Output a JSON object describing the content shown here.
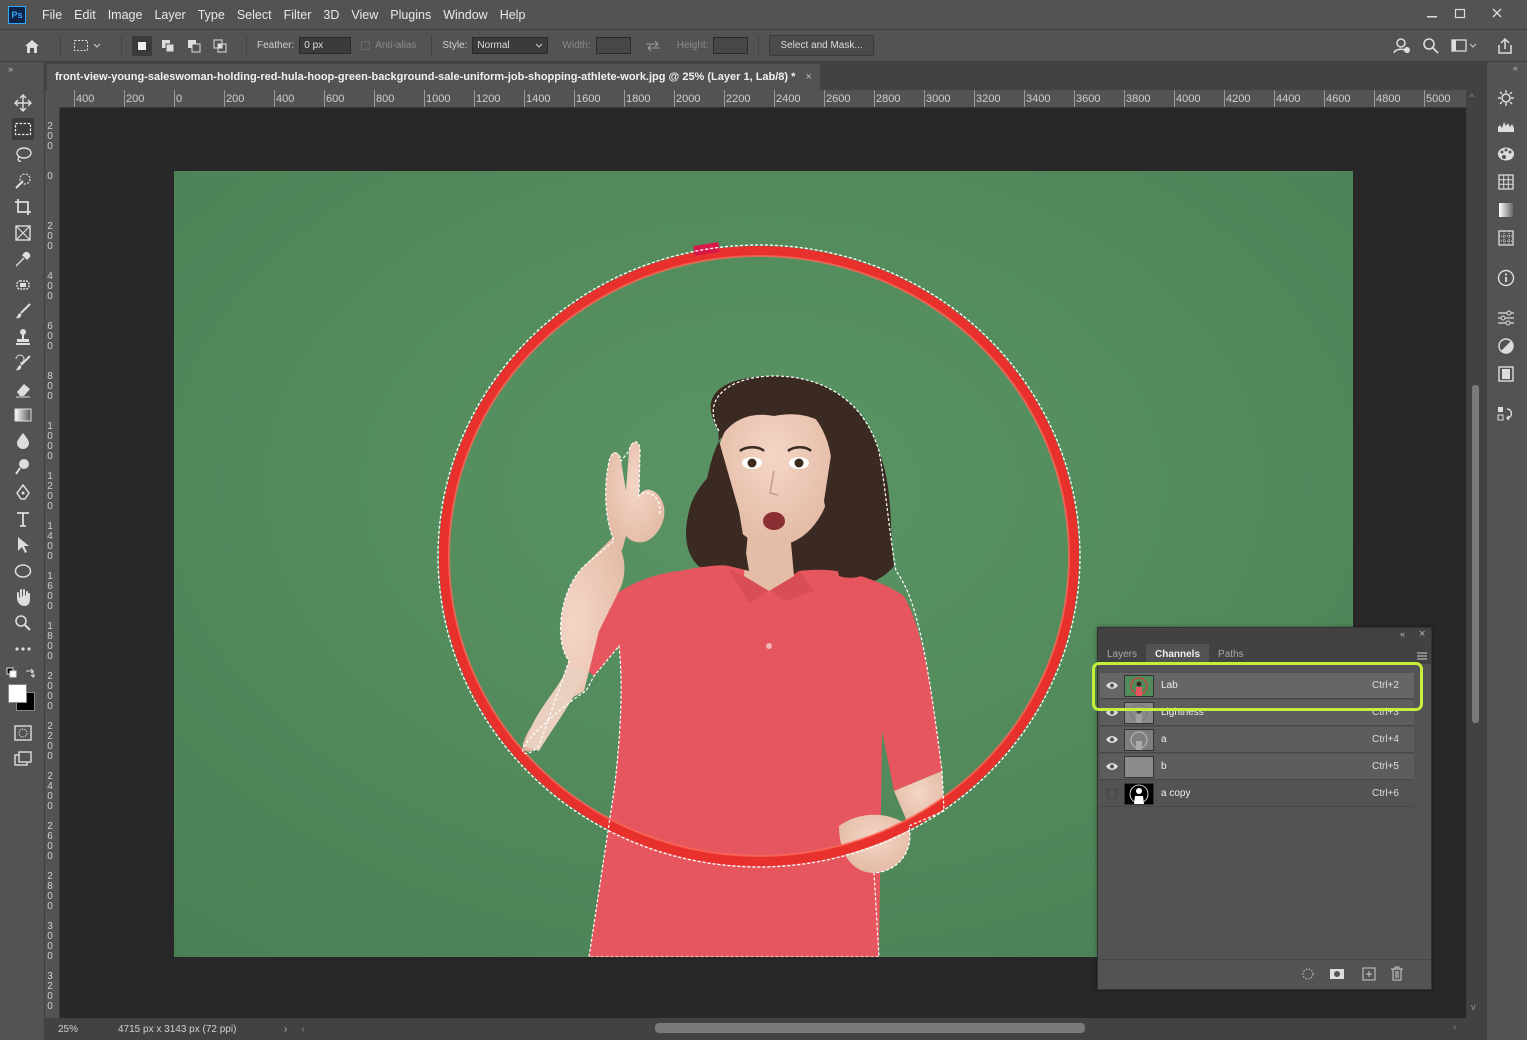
{
  "app": {
    "logo": "Ps",
    "menu": [
      "File",
      "Edit",
      "Image",
      "Layer",
      "Type",
      "Select",
      "Filter",
      "3D",
      "View",
      "Plugins",
      "Window",
      "Help"
    ],
    "window_controls": [
      "minimize-icon",
      "maximize-icon",
      "close-icon"
    ]
  },
  "options_bar": {
    "feather_label": "Feather:",
    "feather_value": "0 px",
    "antialias_label": "Anti-alias",
    "style_label": "Style:",
    "style_value": "Normal",
    "width_label": "Width:",
    "height_label": "Height:",
    "select_mask_label": "Select and Mask..."
  },
  "document": {
    "tab_title": "front-view-young-saleswoman-holding-red-hula-hoop-green-background-sale-uniform-job-shopping-athlete-work.jpg @ 25% (Layer 1, Lab/8) *",
    "close": "×"
  },
  "rulers": {
    "h_labels": [
      "400",
      "200",
      "0",
      "200",
      "400",
      "600",
      "800",
      "1000",
      "1200",
      "1400",
      "1600",
      "1800",
      "2000",
      "2200",
      "2400",
      "2600",
      "2800",
      "3000",
      "3200",
      "3400",
      "3600",
      "3800",
      "4000",
      "4200",
      "4400",
      "4600",
      "4800",
      "5000"
    ],
    "v_labels": [
      "200",
      "0",
      "200",
      "400",
      "600",
      "800",
      "1000",
      "1200",
      "1400",
      "1600",
      "1800",
      "2000",
      "2200",
      "2400",
      "2600",
      "2800",
      "3000",
      "3200"
    ]
  },
  "status": {
    "zoom": "25%",
    "doc_info": "4715 px x 3143 px (72 ppi)"
  },
  "channels_panel": {
    "tabs": [
      "Layers",
      "Channels",
      "Paths"
    ],
    "active_tab": "Channels",
    "rows": [
      {
        "name": "Lab",
        "shortcut": "Ctrl+2",
        "visible": true
      },
      {
        "name": "Lightness",
        "shortcut": "Ctrl+3",
        "visible": true
      },
      {
        "name": "a",
        "shortcut": "Ctrl+4",
        "visible": true
      },
      {
        "name": "b",
        "shortcut": "Ctrl+5",
        "visible": true
      },
      {
        "name": "a copy",
        "shortcut": "Ctrl+6",
        "visible": false
      }
    ],
    "highlight_color": "#c4f03c"
  },
  "colors": {
    "background_green": "#528a5c",
    "hoop_red": "#e8302c",
    "shirt_pink": "#e6565e"
  }
}
